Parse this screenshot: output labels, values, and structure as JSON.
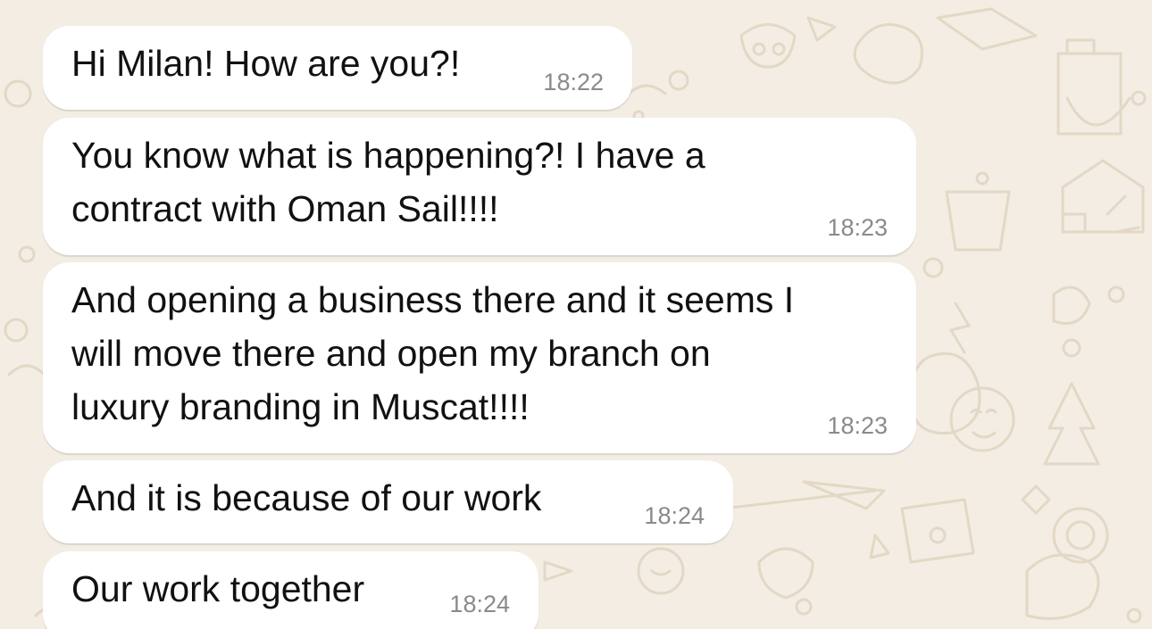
{
  "messages": [
    {
      "text": "Hi Milan! How are you?!",
      "time": "18:22"
    },
    {
      "text": "You know what is happening?! I have a\ncontract with Oman Sail!!!!",
      "time": "18:23"
    },
    {
      "text": "And opening a business there and it seems I\nwill move there and open my branch on\nluxury branding in Muscat!!!!",
      "time": "18:23"
    },
    {
      "text": "And it is because of our work",
      "time": "18:24"
    },
    {
      "text": "Our work together",
      "time": "18:24"
    }
  ],
  "colors": {
    "wallpaper": "#f3ede3",
    "doodle": "#e6dccb",
    "bubble": "#ffffff",
    "text": "#111111",
    "time": "#8a8a8a"
  }
}
